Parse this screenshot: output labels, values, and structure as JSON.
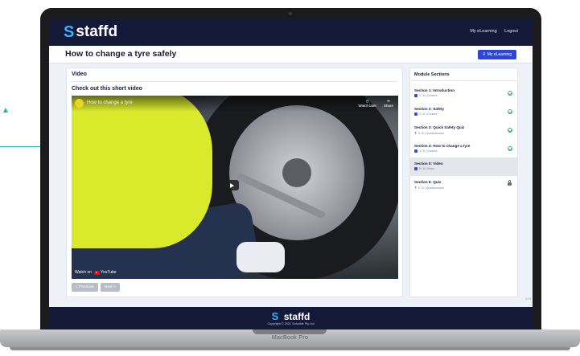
{
  "app": {
    "logo_mark": "S",
    "logo_text": "staffd",
    "nav": {
      "my_elearning": "My eLearning",
      "logout": "Logout"
    }
  },
  "page": {
    "title": "How to change a tyre safely",
    "elearning_button": "My eLearning"
  },
  "main": {
    "card_title": "Video",
    "subtitle": "Check out this short video",
    "video": {
      "title": "How to change a tyre",
      "watch_later": "Watch later",
      "share": "Share",
      "watch_on": "Watch on",
      "youtube": "YouTube"
    },
    "previous_label": "< Previous",
    "next_label": "Next >"
  },
  "sidebar": {
    "title": "Module Sections",
    "sections": [
      {
        "title": "Section 1: Introduction",
        "meta": "1 / 6 | Content",
        "icon": "content-icon",
        "status": "complete"
      },
      {
        "title": "Section 2: Safety",
        "meta": "2 / 6 | Content",
        "icon": "content-icon",
        "status": "complete"
      },
      {
        "title": "Section 3: Quick Safety Quiz",
        "meta": "3 / 6 | Questionnaire",
        "icon": "quiz-icon",
        "status": "complete"
      },
      {
        "title": "Section 4: How to change a tyre",
        "meta": "4 / 6 | Content",
        "icon": "content-icon",
        "status": "complete"
      },
      {
        "title": "Section 5: Video",
        "meta": "5 / 6 | Video",
        "icon": "video-icon",
        "status": "active"
      },
      {
        "title": "Section 6: Quiz",
        "meta": "6 / 6 | Questionnaire",
        "icon": "quiz-icon",
        "status": "locked"
      }
    ],
    "version": "v1.0"
  },
  "footer": {
    "logo_mark": "S",
    "logo_text": "staffd",
    "copyright": "Copyright © 2021 Solvable Pty Ltd"
  },
  "device": {
    "label": "MacBook Pro"
  },
  "colors": {
    "navy": "#14193a",
    "accent_blue": "#2d46d6",
    "complete_green": "#3fb36c",
    "annotation_teal": "#1fb5a8"
  }
}
